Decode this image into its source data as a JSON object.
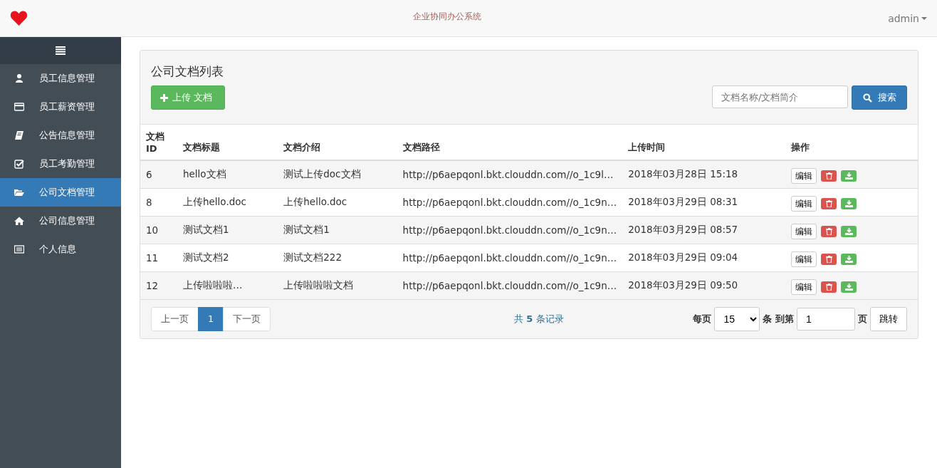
{
  "header": {
    "title": "企业协同办公系统",
    "user": "admin"
  },
  "sidebar": {
    "items": [
      {
        "label": "员工信息管理",
        "selected": false
      },
      {
        "label": "员工薪资管理",
        "selected": false
      },
      {
        "label": "公告信息管理",
        "selected": false
      },
      {
        "label": "员工考勤管理",
        "selected": false
      },
      {
        "label": "公司文档管理",
        "selected": true
      },
      {
        "label": "公司信息管理",
        "selected": false
      },
      {
        "label": "个人信息",
        "selected": false
      }
    ]
  },
  "panel": {
    "title": "公司文档列表",
    "upload_button": "上传 文档",
    "search": {
      "placeholder": "文档名称/文档简介"
    },
    "search_button": "搜索"
  },
  "table": {
    "columns": [
      "文档ID",
      "文档标题",
      "文档介绍",
      "文档路径",
      "上传时间",
      "操作"
    ],
    "rows": [
      {
        "id": "6",
        "title": "hello文档",
        "intro": "测试上传doc文档",
        "path": "http://p6aepqonl.bkt.clouddn.com//o_1c9l…",
        "time": "2018年03月28日 15:18",
        "edit": "编辑"
      },
      {
        "id": "8",
        "title": "上传hello.doc",
        "intro": "上传hello.doc",
        "path": "http://p6aepqonl.bkt.clouddn.com//o_1c9n…",
        "time": "2018年03月29日 08:31",
        "edit": "编辑"
      },
      {
        "id": "10",
        "title": "测试文档1",
        "intro": "测试文档1",
        "path": "http://p6aepqonl.bkt.clouddn.com//o_1c9n…",
        "time": "2018年03月29日 08:57",
        "edit": "编辑"
      },
      {
        "id": "11",
        "title": "测试文档2",
        "intro": "测试文档222",
        "path": "http://p6aepqonl.bkt.clouddn.com//o_1c9n…",
        "time": "2018年03月29日 09:04",
        "edit": "编辑"
      },
      {
        "id": "12",
        "title": "上传啦啦啦…",
        "intro": "上传啦啦啦文档",
        "path": "http://p6aepqonl.bkt.clouddn.com//o_1c9n…",
        "time": "2018年03月29日 09:50",
        "edit": "编辑"
      }
    ]
  },
  "pagination": {
    "pages": [
      {
        "label": "上一页",
        "selected": false
      },
      {
        "label": "1",
        "selected": true
      },
      {
        "label": "下一页",
        "selected": false
      }
    ],
    "total": "共 **5** 条记录",
    "per_page_label": "每页",
    "per_page": "15",
    "goto_label": "条 到第",
    "goto_value": "1",
    "page_label": "页",
    "jump_button": "跳转"
  }
}
